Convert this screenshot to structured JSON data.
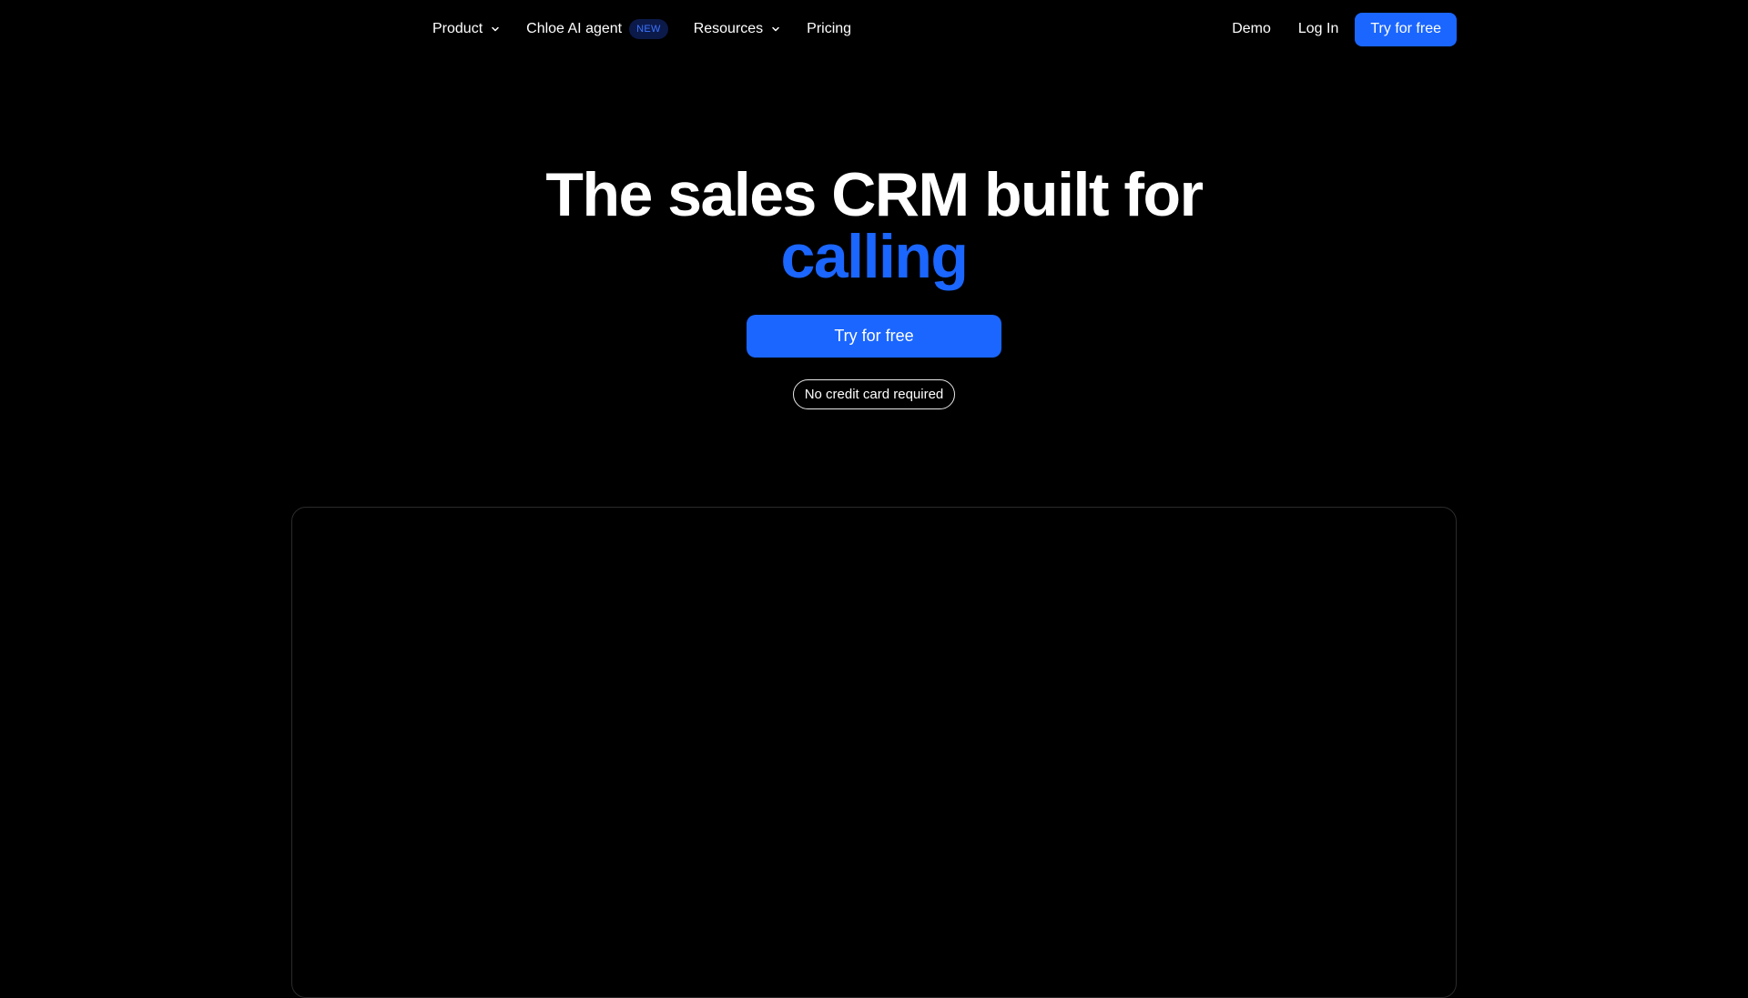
{
  "nav": {
    "product_label": "Product",
    "product_icon": "chevron-down-icon",
    "chloe_label": "Chloe AI agent",
    "chloe_badge": "NEW",
    "resources_label": "Resources",
    "resources_icon": "chevron-down-icon",
    "pricing_label": "Pricing",
    "demo_label": "Demo",
    "login_label": "Log In",
    "cta_label": "Try for free"
  },
  "hero": {
    "title_line1": "The sales CRM built for",
    "title_line2": "calling",
    "cta_label": "Try for free",
    "note": "No credit card required"
  },
  "colors": {
    "background": "#000000",
    "accent": "#1a66ff",
    "badge_bg": "#0c1a4a",
    "badge_text": "#3b74ff"
  }
}
